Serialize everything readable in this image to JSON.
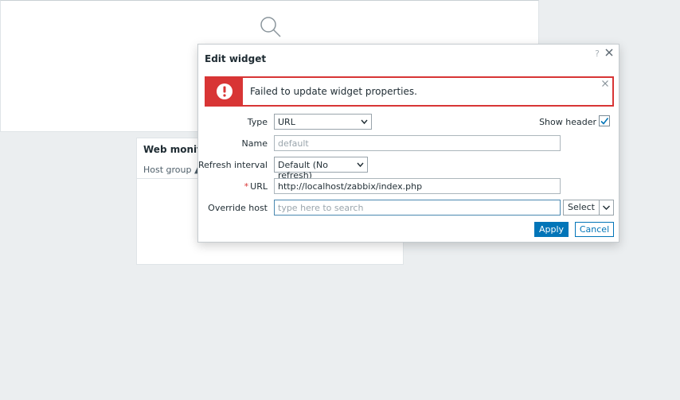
{
  "background": {
    "web_widget_title": "Web monitor",
    "web_widget_column": "Host group ▲"
  },
  "dialog": {
    "title": "Edit widget",
    "help": "?",
    "error": {
      "message": "Failed to update widget properties.",
      "color": "#d83535"
    },
    "form": {
      "type_label": "Type",
      "type_value": "URL",
      "show_header_label": "Show header",
      "show_header_checked": true,
      "name_label": "Name",
      "name_placeholder": "default",
      "refresh_label": "Refresh interval",
      "refresh_value": "Default (No refresh)",
      "url_required_mark": "*",
      "url_label": "URL",
      "url_value": "http://localhost/zabbix/index.php",
      "override_label": "Override host",
      "override_placeholder": "type here to search",
      "select_button": "Select"
    },
    "buttons": {
      "apply": "Apply",
      "cancel": "Cancel"
    },
    "accent_color": "#0275b8"
  }
}
